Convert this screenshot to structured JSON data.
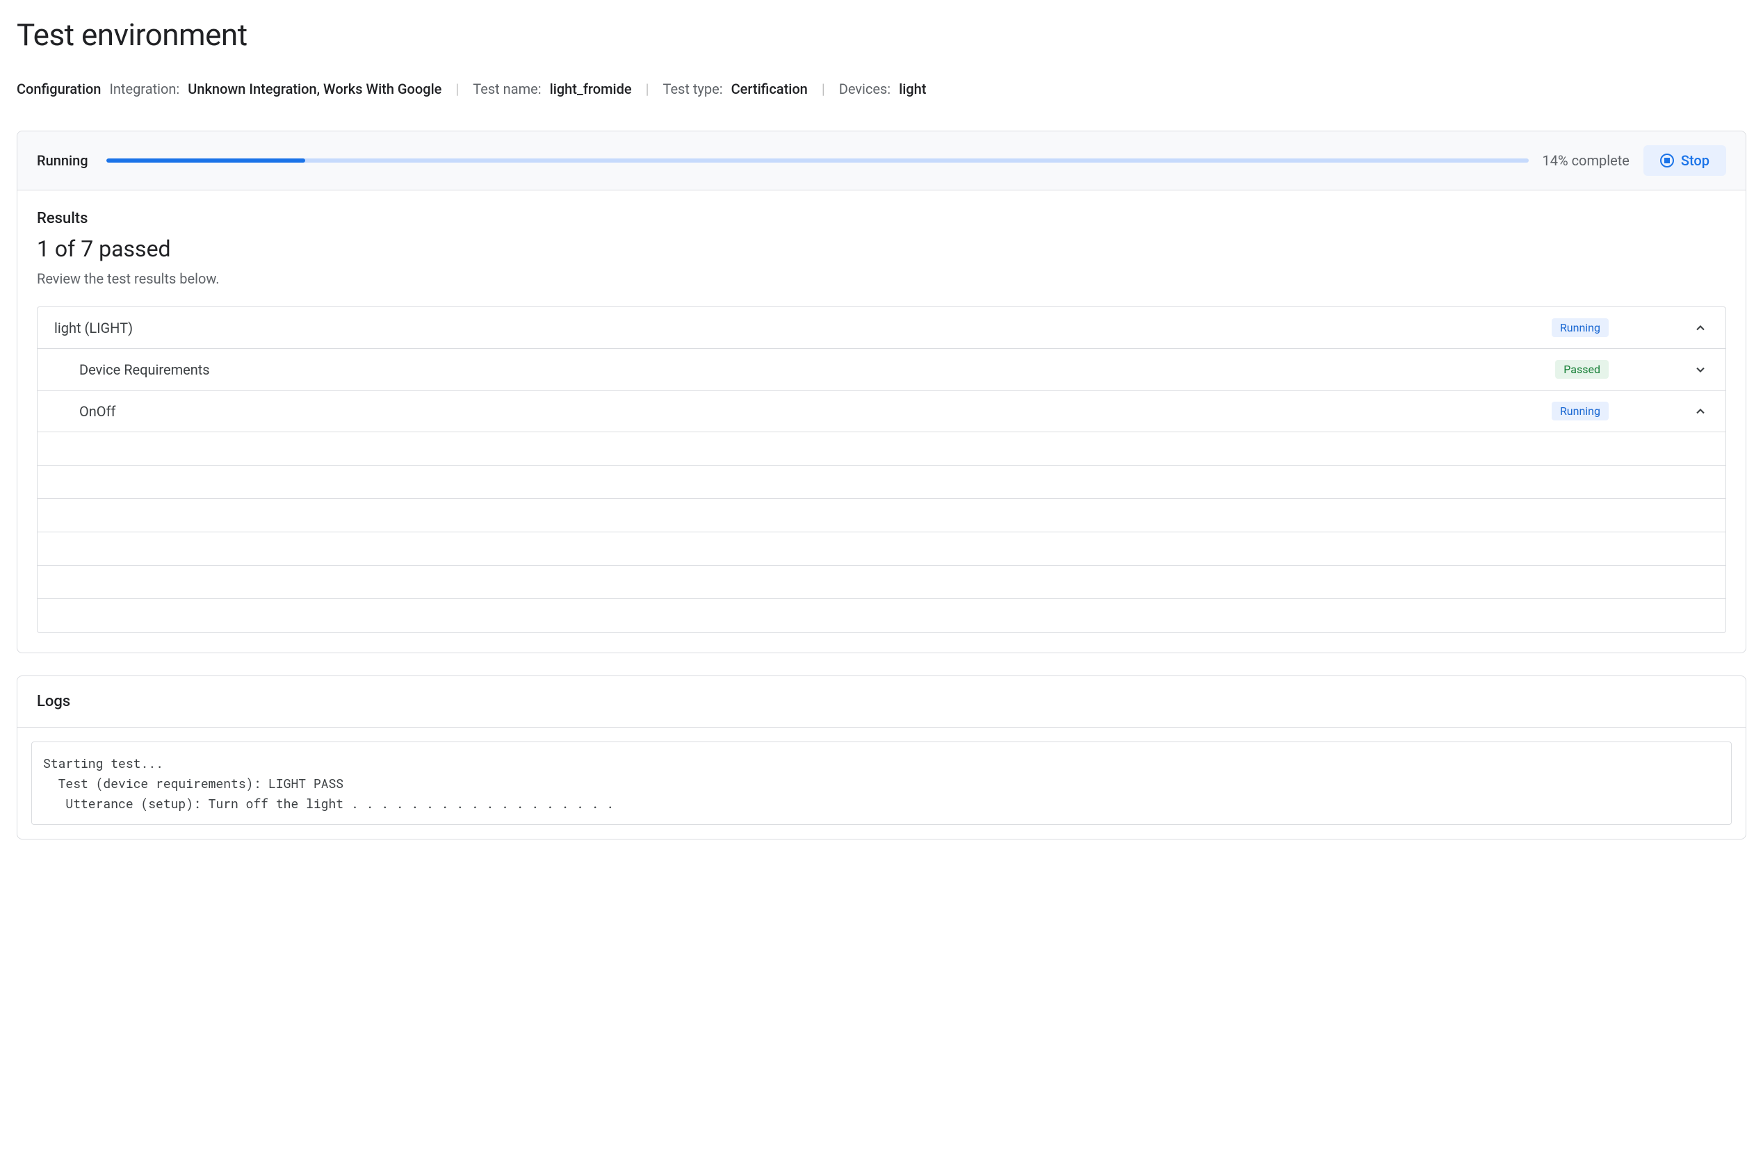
{
  "page_title": "Test environment",
  "config": {
    "label": "Configuration",
    "integration_label": "Integration:",
    "integration_value": "Unknown Integration, Works With Google",
    "test_name_label": "Test name:",
    "test_name_value": "light_fromide",
    "test_type_label": "Test type:",
    "test_type_value": "Certification",
    "devices_label": "Devices:",
    "devices_value": "light"
  },
  "progress": {
    "status": "Running",
    "percent": 14,
    "percent_text": "14% complete",
    "stop_label": "Stop"
  },
  "results": {
    "title": "Results",
    "summary": "1 of 7 passed",
    "subtitle": "Review the test results below.",
    "rows": [
      {
        "name": "light (LIGHT)",
        "badge": "Running",
        "badge_type": "running",
        "indent": 0,
        "expanded": true
      },
      {
        "name": "Device Requirements",
        "badge": "Passed",
        "badge_type": "passed",
        "indent": 1,
        "expanded": false
      },
      {
        "name": "OnOff",
        "badge": "Running",
        "badge_type": "running",
        "indent": 1,
        "expanded": true
      }
    ]
  },
  "logs": {
    "title": "Logs",
    "content": "Starting test...\n  Test (device requirements): LIGHT PASS\n   Utterance (setup): Turn off the light . . . . . . . . . . . . . . . . . ."
  }
}
